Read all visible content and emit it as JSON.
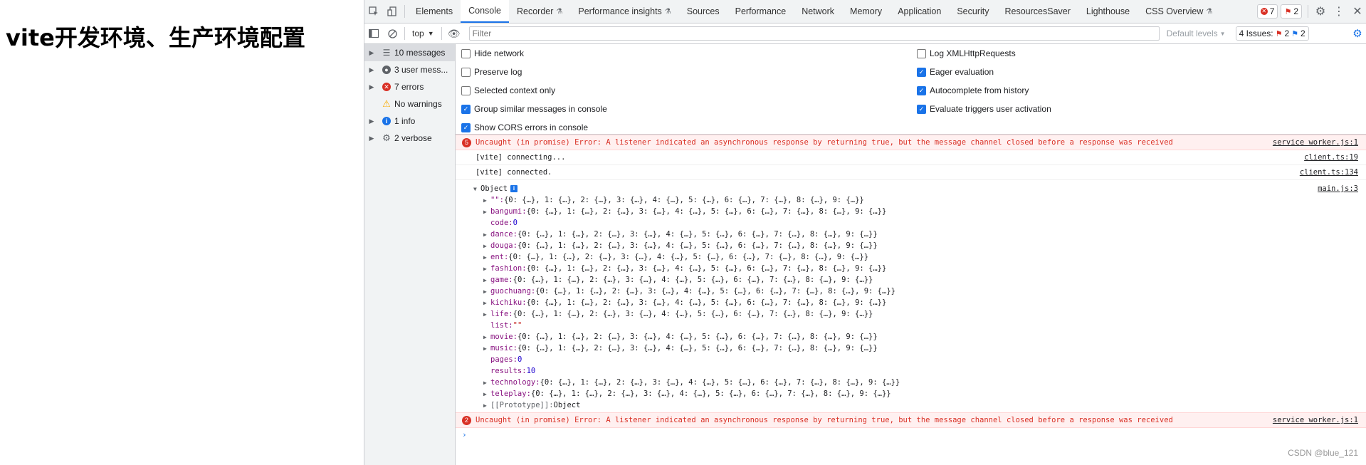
{
  "page": {
    "heading": "vite开发环境、生产环境配置"
  },
  "devtools": {
    "tabs": [
      {
        "label": "Elements"
      },
      {
        "label": "Console"
      },
      {
        "label": "Recorder"
      },
      {
        "label": "Performance insights"
      },
      {
        "label": "Sources"
      },
      {
        "label": "Performance"
      },
      {
        "label": "Network"
      },
      {
        "label": "Memory"
      },
      {
        "label": "Application"
      },
      {
        "label": "Security"
      },
      {
        "label": "ResourcesSaver"
      },
      {
        "label": "Lighthouse"
      },
      {
        "label": "CSS Overview"
      }
    ],
    "active_tab": "Console",
    "error_count": "7",
    "issue_count": "2"
  },
  "toolbar": {
    "context": "top",
    "filter_placeholder": "Filter",
    "levels": "Default levels",
    "issues_label": "4 Issues:",
    "issues_errors": "2",
    "issues_info": "2"
  },
  "sidebar": {
    "items": [
      {
        "label": "10 messages",
        "icon": "list-icon"
      },
      {
        "label": "3 user mess...",
        "icon": "user-icon"
      },
      {
        "label": "7 errors",
        "icon": "error-icon"
      },
      {
        "label": "No warnings",
        "icon": "warning-icon"
      },
      {
        "label": "1 info",
        "icon": "info-icon"
      },
      {
        "label": "2 verbose",
        "icon": "gear-icon"
      }
    ]
  },
  "settings": {
    "left": [
      {
        "label": "Hide network",
        "checked": false
      },
      {
        "label": "Preserve log",
        "checked": false
      },
      {
        "label": "Selected context only",
        "checked": false
      },
      {
        "label": "Group similar messages in console",
        "checked": true
      },
      {
        "label": "Show CORS errors in console",
        "checked": true
      }
    ],
    "right": [
      {
        "label": "Log XMLHttpRequests",
        "checked": false
      },
      {
        "label": "Eager evaluation",
        "checked": true
      },
      {
        "label": "Autocomplete from history",
        "checked": true
      },
      {
        "label": "Evaluate triggers user activation",
        "checked": true
      }
    ]
  },
  "messages": {
    "error1": {
      "count": "5",
      "text": "Uncaught (in promise) Error: A listener indicated an asynchronous response by returning true, but the message channel closed before a response was received",
      "source": "service worker.js:1"
    },
    "log1": {
      "text": "[vite] connecting...",
      "source": "client.ts:19"
    },
    "log2": {
      "text": "[vite] connected.",
      "source": "client.ts:134"
    },
    "object": {
      "label": "Object",
      "source": "main.js:3",
      "props": [
        {
          "key": "\"\"",
          "value": "{0: {…}, 1: {…}, 2: {…}, 3: {…}, 4: {…}, 5: {…}, 6: {…}, 7: {…}, 8: {…}, 9: {…}}"
        },
        {
          "key": "bangumi",
          "value": "{0: {…}, 1: {…}, 2: {…}, 3: {…}, 4: {…}, 5: {…}, 6: {…}, 7: {…}, 8: {…}, 9: {…}}"
        },
        {
          "key": "code",
          "value": "0",
          "leaf": "num"
        },
        {
          "key": "dance",
          "value": "{0: {…}, 1: {…}, 2: {…}, 3: {…}, 4: {…}, 5: {…}, 6: {…}, 7: {…}, 8: {…}, 9: {…}}"
        },
        {
          "key": "douga",
          "value": "{0: {…}, 1: {…}, 2: {…}, 3: {…}, 4: {…}, 5: {…}, 6: {…}, 7: {…}, 8: {…}, 9: {…}}"
        },
        {
          "key": "ent",
          "value": "{0: {…}, 1: {…}, 2: {…}, 3: {…}, 4: {…}, 5: {…}, 6: {…}, 7: {…}, 8: {…}, 9: {…}}"
        },
        {
          "key": "fashion",
          "value": "{0: {…}, 1: {…}, 2: {…}, 3: {…}, 4: {…}, 5: {…}, 6: {…}, 7: {…}, 8: {…}, 9: {…}}"
        },
        {
          "key": "game",
          "value": "{0: {…}, 1: {…}, 2: {…}, 3: {…}, 4: {…}, 5: {…}, 6: {…}, 7: {…}, 8: {…}, 9: {…}}"
        },
        {
          "key": "guochuang",
          "value": "{0: {…}, 1: {…}, 2: {…}, 3: {…}, 4: {…}, 5: {…}, 6: {…}, 7: {…}, 8: {…}, 9: {…}}"
        },
        {
          "key": "kichiku",
          "value": "{0: {…}, 1: {…}, 2: {…}, 3: {…}, 4: {…}, 5: {…}, 6: {…}, 7: {…}, 8: {…}, 9: {…}}"
        },
        {
          "key": "life",
          "value": "{0: {…}, 1: {…}, 2: {…}, 3: {…}, 4: {…}, 5: {…}, 6: {…}, 7: {…}, 8: {…}, 9: {…}}"
        },
        {
          "key": "list",
          "value": "\"\"",
          "leaf": "str"
        },
        {
          "key": "movie",
          "value": "{0: {…}, 1: {…}, 2: {…}, 3: {…}, 4: {…}, 5: {…}, 6: {…}, 7: {…}, 8: {…}, 9: {…}}"
        },
        {
          "key": "music",
          "value": "{0: {…}, 1: {…}, 2: {…}, 3: {…}, 4: {…}, 5: {…}, 6: {…}, 7: {…}, 8: {…}, 9: {…}}"
        },
        {
          "key": "pages",
          "value": "0",
          "leaf": "num"
        },
        {
          "key": "results",
          "value": "10",
          "leaf": "num"
        },
        {
          "key": "technology",
          "value": "{0: {…}, 1: {…}, 2: {…}, 3: {…}, 4: {…}, 5: {…}, 6: {…}, 7: {…}, 8: {…}, 9: {…}}"
        },
        {
          "key": "teleplay",
          "value": "{0: {…}, 1: {…}, 2: {…}, 3: {…}, 4: {…}, 5: {…}, 6: {…}, 7: {…}, 8: {…}, 9: {…}}"
        },
        {
          "key": "[[Prototype]]",
          "value": "Object",
          "proto": true
        }
      ]
    },
    "error2": {
      "count": "2",
      "text": "Uncaught (in promise) Error: A listener indicated an asynchronous response by returning true, but the message channel closed before a response was received",
      "source": "service worker.js:1"
    }
  },
  "watermark": "CSDN @blue_121",
  "colors": {
    "accent": "#1a73e8",
    "error": "#d93025",
    "error_bg": "#fff0f0",
    "panel_bg": "#f1f3f4"
  }
}
